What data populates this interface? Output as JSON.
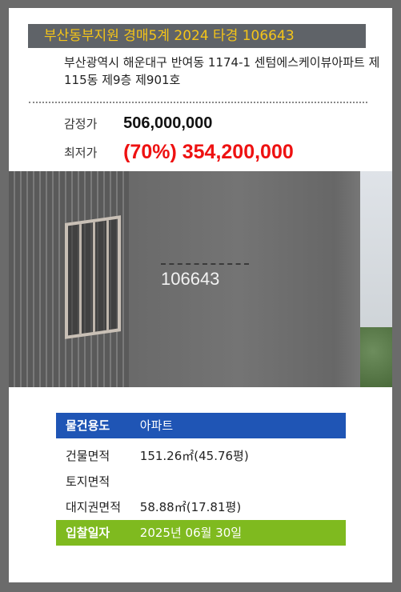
{
  "header": {
    "title": "부산동부지원 경매5계 2024 타경 106643"
  },
  "address": "부산광역시 해운대구 반여동 1174-1 센텀에스케이뷰아파트 제115동 제9층 제901호",
  "prices": {
    "appraisal_label": "감정가",
    "appraisal_value": "506,000,000",
    "minimum_label": "최저가",
    "minimum_value": "(70%) 354,200,000"
  },
  "photo": {
    "caption": "106643"
  },
  "details": [
    {
      "key": "물건용도",
      "value": "아파트",
      "style": "blue"
    },
    {
      "key": "건물면적",
      "value": "151.26㎡(45.76평)",
      "style": "plain"
    },
    {
      "key": "토지면적",
      "value": "",
      "style": "plain"
    },
    {
      "key": "대지권면적",
      "value": "58.88㎡(17.81평)",
      "style": "plain"
    },
    {
      "key": "입찰일자",
      "value": "2025년 06월 30일",
      "style": "green"
    }
  ],
  "colors": {
    "blue_row": "#1f55b5",
    "green_row": "#7fba1f",
    "title_text": "#f5c518",
    "min_price": "#ee1111"
  }
}
